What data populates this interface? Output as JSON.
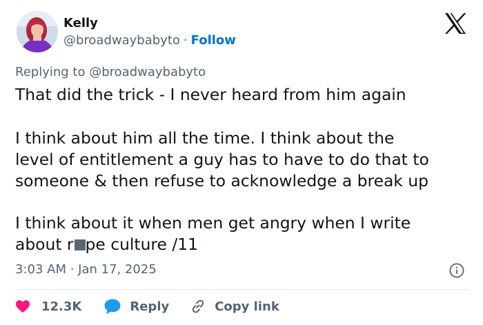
{
  "author": {
    "name": "Kelly",
    "handle": "@broadwaybabyto",
    "separator": "·",
    "follow_label": "Follow"
  },
  "reply_context": {
    "prefix": "Replying to",
    "mention": "@broadwaybabyto"
  },
  "tweet": {
    "line1": "That did the trick - I never heard from him again",
    "line2": "I think about him all the time. I think about the",
    "line3": "level of entitlement a guy has to have to do that to",
    "line4": "someone & then refuse to acknowledge a break up",
    "line5": "I think about it when men get angry when I write",
    "line6_start": "about r",
    "line6_end": "pe culture /11"
  },
  "timestamp": "3:03 AM · Jan 17, 2025",
  "actions": {
    "like_count": "12.3K",
    "reply_label": "Reply",
    "copy_link_label": "Copy link"
  },
  "colors": {
    "text": "#0f1419",
    "secondary": "#536471",
    "link_blue": "#006fd6",
    "like_red": "#f91880",
    "reply_blue": "#1d9bf0",
    "divider": "#e1e8ed"
  },
  "icons": [
    "avatar-photo",
    "x-logo-icon",
    "info-icon",
    "heart-icon",
    "reply-bubble-icon",
    "link-icon"
  ]
}
